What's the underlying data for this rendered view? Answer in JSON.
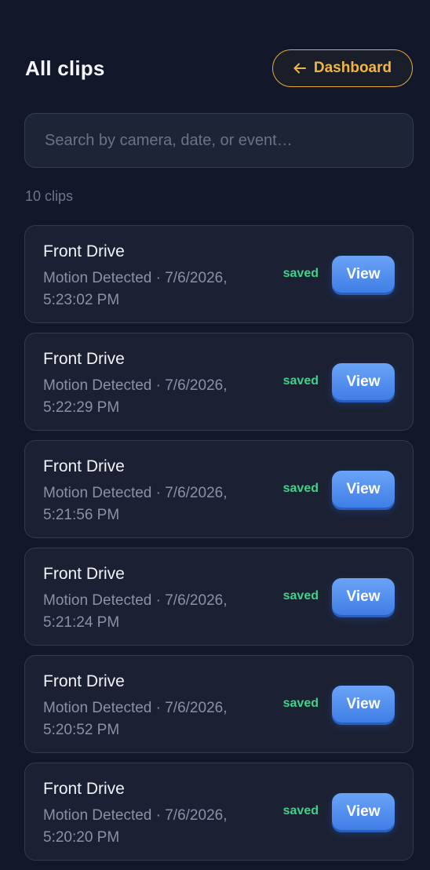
{
  "header": {
    "title": "All clips",
    "dashboard_label": "Dashboard",
    "dashboard_icon": "arrow-left-icon",
    "accent_color": "#f0b547"
  },
  "search": {
    "value": "",
    "placeholder": "Search by camera, date, or event…"
  },
  "clip_count": "10 clips",
  "clips": [
    {
      "camera": "Front Drive",
      "meta": "Motion Detected · 7/6/2026, 5:23:02 PM",
      "status": "saved",
      "action": "View"
    },
    {
      "camera": "Front Drive",
      "meta": "Motion Detected · 7/6/2026, 5:22:29 PM",
      "status": "saved",
      "action": "View"
    },
    {
      "camera": "Front Drive",
      "meta": "Motion Detected · 7/6/2026, 5:21:56 PM",
      "status": "saved",
      "action": "View"
    },
    {
      "camera": "Front Drive",
      "meta": "Motion Detected · 7/6/2026, 5:21:24 PM",
      "status": "saved",
      "action": "View"
    },
    {
      "camera": "Front Drive",
      "meta": "Motion Detected · 7/6/2026, 5:20:52 PM",
      "status": "saved",
      "action": "View"
    },
    {
      "camera": "Front Drive",
      "meta": "Motion Detected · 7/6/2026, 5:20:20 PM",
      "status": "saved",
      "action": "View"
    }
  ],
  "colors": {
    "background": "#121829",
    "card": "#1b2133",
    "status_saved": "#3fd28a",
    "view_button": "#4f8ef0"
  }
}
